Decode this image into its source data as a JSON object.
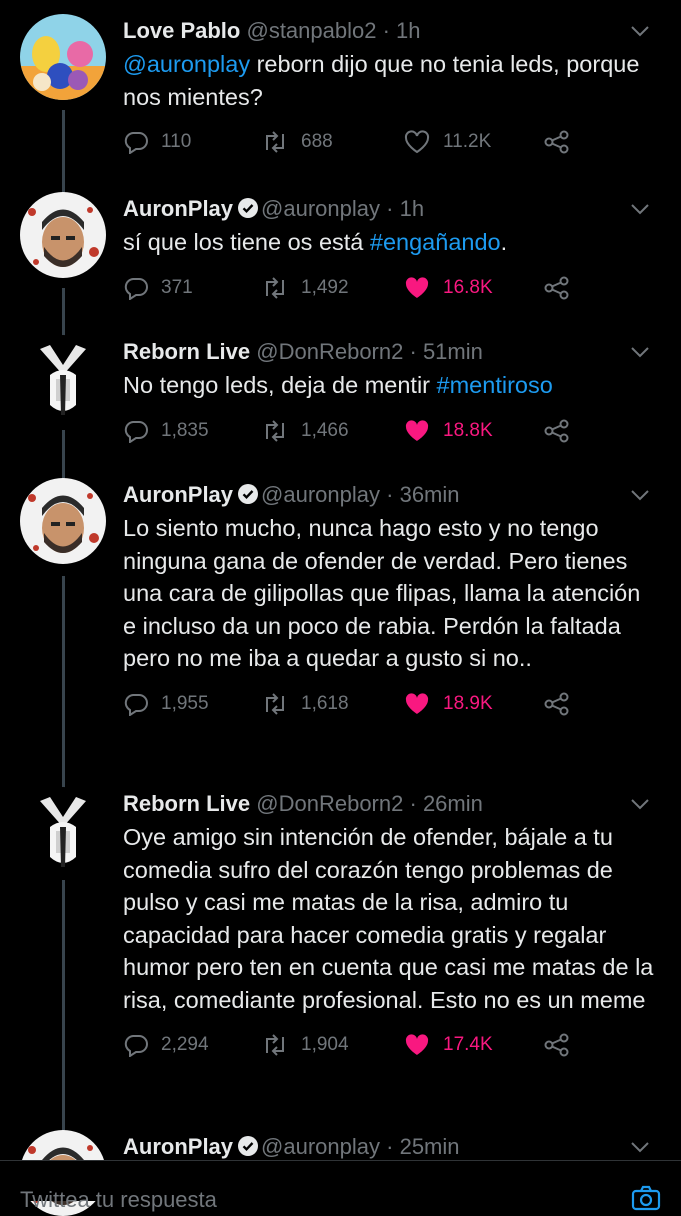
{
  "tweets": [
    {
      "name": "Love Pablo",
      "handle": "@stanpablo2",
      "dot": "·",
      "time": "1h",
      "verified": false,
      "text_parts": [
        {
          "t": "@auronplay",
          "kind": "mention"
        },
        {
          "t": " reborn dijo que no tenia leds, porque nos mientes?",
          "kind": "plain"
        }
      ],
      "replies": "110",
      "retweets": "688",
      "likes": "11.2K",
      "liked": false,
      "avatar": "backyardigans-avatar"
    },
    {
      "name": "AuronPlay",
      "handle": "@auronplay",
      "dot": "·",
      "time": "1h",
      "verified": true,
      "text_parts": [
        {
          "t": "sí que los tiene os está ",
          "kind": "plain"
        },
        {
          "t": "#engañando",
          "kind": "hashtag"
        },
        {
          "t": ".",
          "kind": "plain"
        }
      ],
      "replies": "371",
      "retweets": "1,492",
      "likes": "16.8K",
      "liked": true,
      "avatar": "auronplay-avatar"
    },
    {
      "name": "Reborn Live",
      "handle": "@DonReborn2",
      "dot": "·",
      "time": "51min",
      "verified": false,
      "text_parts": [
        {
          "t": "No tengo leds, deja de mentir ",
          "kind": "plain"
        },
        {
          "t": "#mentiroso",
          "kind": "hashtag"
        }
      ],
      "replies": "1,835",
      "retweets": "1,466",
      "likes": "18.8K",
      "liked": true,
      "avatar": "reborn-avatar"
    },
    {
      "name": "AuronPlay",
      "handle": "@auronplay",
      "dot": "·",
      "time": "36min",
      "verified": true,
      "text_parts": [
        {
          "t": "Lo siento mucho, nunca hago esto y no tengo ninguna gana de ofender de verdad. Pero tienes una cara de gilipollas que flipas, llama la atención e incluso da un poco de rabia. Perdón la faltada pero no me iba a quedar a gusto si no..",
          "kind": "plain"
        }
      ],
      "replies": "1,955",
      "retweets": "1,618",
      "likes": "18.9K",
      "liked": true,
      "avatar": "auronplay-avatar"
    },
    {
      "name": "Reborn Live",
      "handle": "@DonReborn2",
      "dot": "·",
      "time": "26min",
      "verified": false,
      "text_parts": [
        {
          "t": "Oye amigo sin intención de ofender, bájale a tu comedia sufro del corazón tengo problemas de pulso y casi me matas de la risa, admiro tu capacidad para hacer comedia gratis y regalar humor pero ten en cuenta que casi me matas de la risa, comediante profesional. Esto no es un meme",
          "kind": "plain"
        }
      ],
      "replies": "2,294",
      "retweets": "1,904",
      "likes": "17.4K",
      "liked": true,
      "avatar": "reborn-avatar"
    },
    {
      "name": "AuronPlay",
      "handle": "@auronplay",
      "dot": "·",
      "time": "25min",
      "verified": true,
      "text_parts": [],
      "avatar": "auronplay-avatar"
    }
  ],
  "reply_bar": {
    "placeholder": "Twittea tu respuesta"
  },
  "colors": {
    "background": "#000000",
    "text": "#e7e9ea",
    "muted": "#71767b",
    "link": "#1d9bf0",
    "like": "#f91880",
    "thread_line": "#38444d"
  }
}
